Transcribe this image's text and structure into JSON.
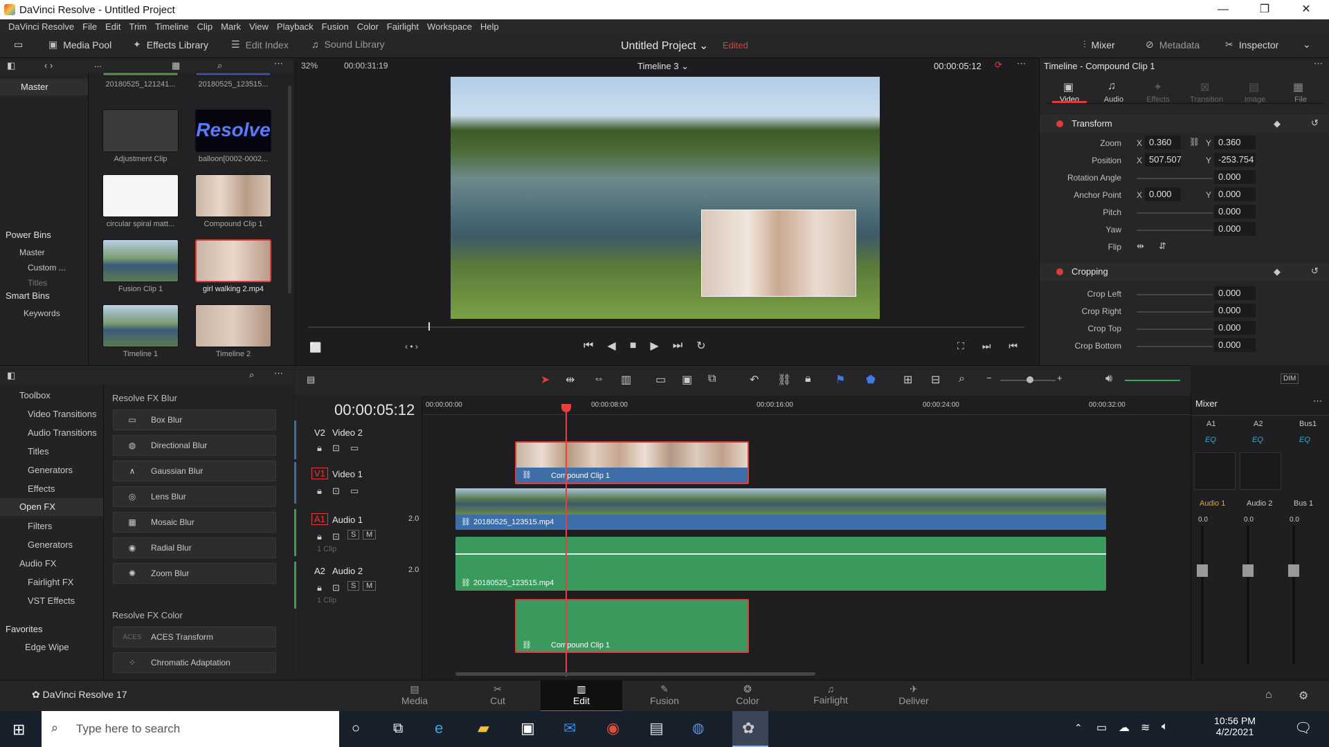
{
  "window": {
    "title": "DaVinci Resolve - Untitled Project"
  },
  "menu": [
    "DaVinci Resolve",
    "File",
    "Edit",
    "Trim",
    "Timeline",
    "Clip",
    "Mark",
    "View",
    "Playback",
    "Fusion",
    "Color",
    "Fairlight",
    "Workspace",
    "Help"
  ],
  "toolbar": {
    "media_pool": "Media Pool",
    "effects_library": "Effects Library",
    "edit_index": "Edit Index",
    "sound_library": "Sound Library",
    "project": "Untitled Project",
    "edited": "Edited",
    "mixer": "Mixer",
    "metadata": "Metadata",
    "inspector": "Inspector"
  },
  "media_pool": {
    "master": "Master",
    "power_bins": "Power Bins",
    "pb_master": "Master",
    "pb_custom": "Custom ...",
    "pb_titles": "Titles",
    "smart_bins": "Smart Bins",
    "keywords": "Keywords",
    "clips": [
      {
        "label": "20180525_121241..."
      },
      {
        "label": "20180525_123515..."
      },
      {
        "label": "Adjustment Clip"
      },
      {
        "label": "balloon[0002-0002..."
      },
      {
        "label": "circular spiral matt..."
      },
      {
        "label": "Compound Clip 1"
      },
      {
        "label": "Fusion Clip 1"
      },
      {
        "label": "girl walking 2.mp4"
      },
      {
        "label": "Timeline 1"
      },
      {
        "label": "Timeline 2"
      }
    ],
    "resolve_text": "Resolve"
  },
  "viewer": {
    "zoom": "32%",
    "source_tc": "00:00:31:19",
    "timeline_name": "Timeline 3",
    "tc": "00:00:05:12"
  },
  "inspector": {
    "title": "Timeline - Compound Clip 1",
    "tabs": [
      "Video",
      "Audio",
      "Effects",
      "Transition",
      "Image",
      "File"
    ],
    "transform_label": "Transform",
    "zoom_label": "Zoom",
    "zoom_x": "0.360",
    "zoom_y": "0.360",
    "position_label": "Position",
    "pos_x": "507.507",
    "pos_y": "-253.754",
    "rotation_label": "Rotation Angle",
    "rotation": "0.000",
    "anchor_label": "Anchor Point",
    "anchor_x": "0.000",
    "anchor_y": "0.000",
    "pitch_label": "Pitch",
    "pitch": "0.000",
    "yaw_label": "Yaw",
    "yaw": "0.000",
    "flip_label": "Flip",
    "cropping_label": "Cropping",
    "crop_left_label": "Crop Left",
    "crop_left": "0.000",
    "crop_right_label": "Crop Right",
    "crop_right": "0.000",
    "crop_top_label": "Crop Top",
    "crop_top": "0.000",
    "crop_bottom_label": "Crop Bottom",
    "crop_bottom": "0.000",
    "x": "X",
    "y": "Y"
  },
  "effects": {
    "toolbox": "Toolbox",
    "video_transitions": "Video Transitions",
    "audio_transitions": "Audio Transitions",
    "titles": "Titles",
    "generators": "Generators",
    "effects": "Effects",
    "openfx": "Open FX",
    "filters": "Filters",
    "generators2": "Generators",
    "audiofx": "Audio FX",
    "fairlight_fx": "Fairlight FX",
    "vst": "VST Effects",
    "favorites": "Favorites",
    "edge_wipe": "Edge Wipe",
    "blur_header": "Resolve FX Blur",
    "blur": [
      "Box Blur",
      "Directional Blur",
      "Gaussian Blur",
      "Lens Blur",
      "Mosaic Blur",
      "Radial Blur",
      "Zoom Blur"
    ],
    "color_header": "Resolve FX Color",
    "color": [
      "ACES Transform",
      "Chromatic Adaptation"
    ]
  },
  "timeline": {
    "tc": "00:00:05:12",
    "ruler": [
      "00:00:00:00",
      "00:00:08:00",
      "00:00:16:00",
      "00:00:24:00",
      "00:00:32:00"
    ],
    "tracks": [
      {
        "id": "V2",
        "name": "Video 2"
      },
      {
        "id": "V1",
        "name": "Video 1"
      },
      {
        "id": "A1",
        "name": "Audio 1",
        "level": "2.0",
        "clips": "1 Clip"
      },
      {
        "id": "A2",
        "name": "Audio 2",
        "level": "2.0",
        "clips": "1 Clip"
      }
    ],
    "clip_v2": "Compound Clip 1",
    "clip_v1": "20180525_123515.mp4",
    "clip_a1": "20180525_123515.mp4",
    "clip_a2": "Compound Clip 1",
    "s": "S",
    "m": "M"
  },
  "mixer": {
    "title": "Mixer",
    "channels": [
      "A1",
      "A2",
      "Bus1"
    ],
    "eq": "EQ",
    "names": [
      "Audio 1",
      "Audio 2",
      "Bus 1"
    ],
    "db": "0.0",
    "dim": "DIM"
  },
  "pages": [
    "Media",
    "Cut",
    "Edit",
    "Fusion",
    "Color",
    "Fairlight",
    "Deliver"
  ],
  "app_version": "DaVinci Resolve 17",
  "taskbar": {
    "search": "Type here to search",
    "time": "10:56 PM",
    "date": "4/2/2021"
  },
  "colors": {
    "accent": "#e03a3a",
    "video_clip": "#3d6ea8",
    "audio_clip": "#3a9a5e",
    "playhead": "#e8403a"
  }
}
